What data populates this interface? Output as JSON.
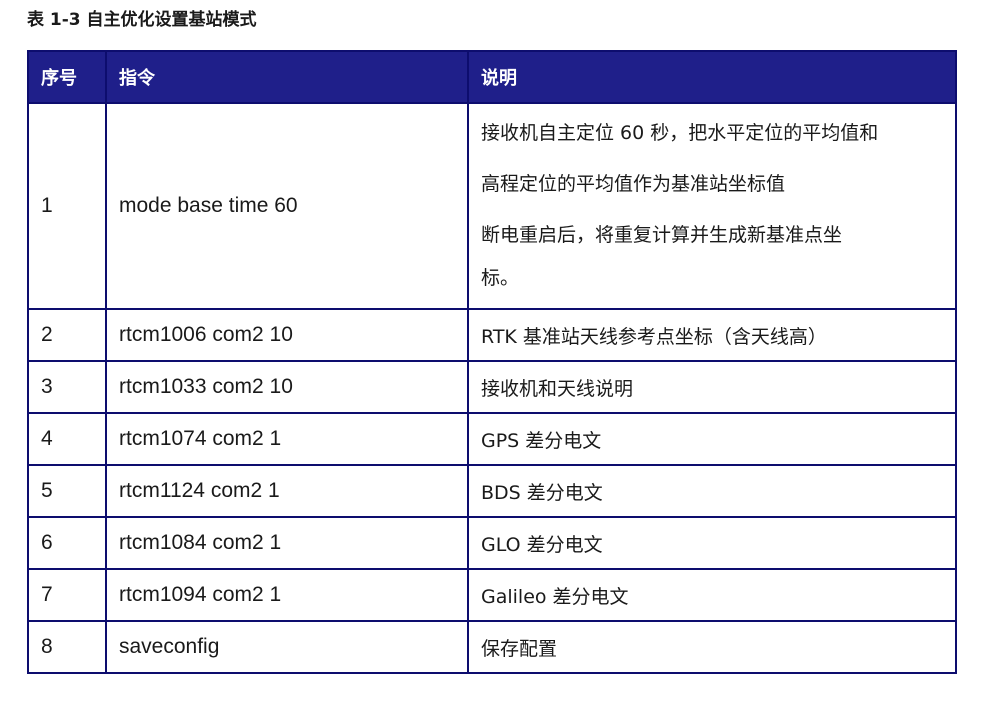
{
  "caption": "表 1-3 自主优化设置基站模式",
  "table": {
    "headers": [
      "序号",
      "指令",
      "说明"
    ],
    "rows": [
      {
        "index": "1",
        "command": "mode base time 60",
        "description_lines": [
          "接收机自主定位 60 秒，把水平定位的平均值和",
          "高程定位的平均值作为基准站坐标值",
          "断电重启后，将重复计算并生成新基准点坐",
          "标。"
        ]
      },
      {
        "index": "2",
        "command": "rtcm1006 com2 10",
        "description": "RTK 基准站天线参考点坐标（含天线高）"
      },
      {
        "index": "3",
        "command": "rtcm1033 com2 10",
        "description": "接收机和天线说明"
      },
      {
        "index": "4",
        "command": "rtcm1074 com2 1",
        "description": "GPS 差分电文"
      },
      {
        "index": "5",
        "command": "rtcm1124 com2 1",
        "description": "BDS 差分电文"
      },
      {
        "index": "6",
        "command": "rtcm1084 com2 1",
        "description": "GLO 差分电文"
      },
      {
        "index": "7",
        "command": "rtcm1094 com2 1",
        "description": "Galileo 差分电文"
      },
      {
        "index": "8",
        "command": "saveconfig",
        "description": "保存配置"
      }
    ]
  },
  "colors": {
    "header_bg": "#1f1f8a",
    "header_text": "#ffffff",
    "border": "#0d0d6e"
  }
}
